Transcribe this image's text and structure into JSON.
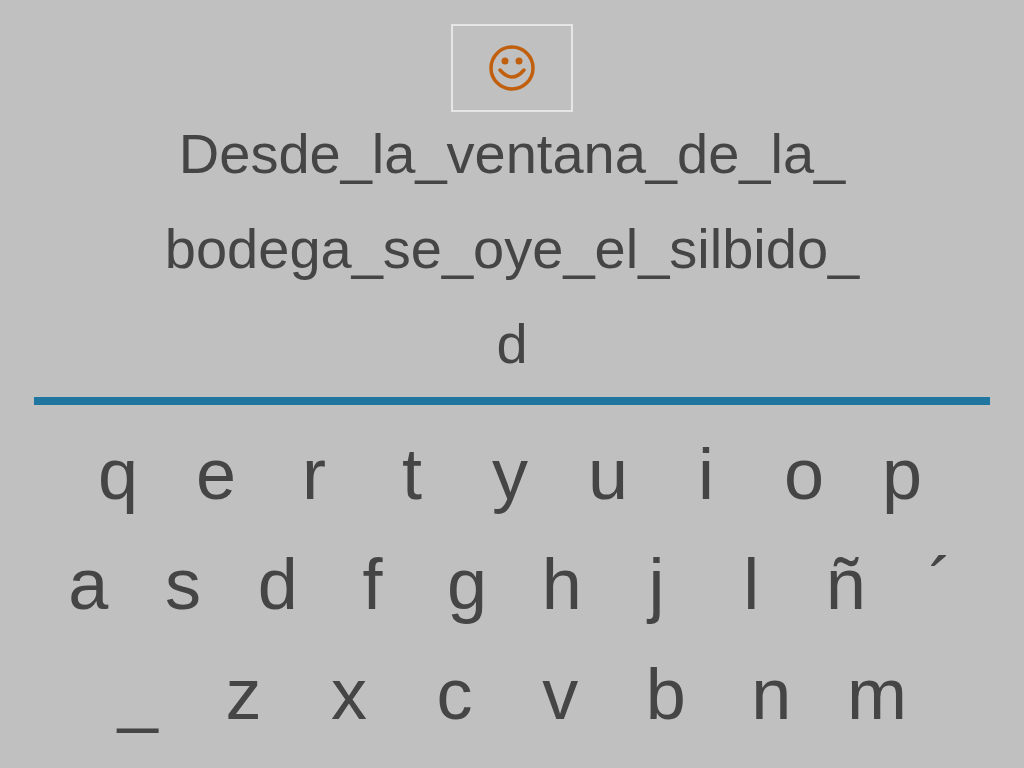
{
  "phrase_lines": [
    "Desde_la_ventana_de_la_",
    "bodega_se_oye_el_silbido_",
    "d"
  ],
  "keyboard_rows": [
    [
      "q",
      "e",
      "r",
      "t",
      "y",
      "u",
      "i",
      "o",
      "p"
    ],
    [
      "a",
      "s",
      "d",
      "f",
      "g",
      "h",
      "j",
      "l",
      "ñ",
      "´"
    ],
    [
      "_",
      "z",
      "x",
      "c",
      "v",
      "b",
      "n",
      "m"
    ]
  ]
}
